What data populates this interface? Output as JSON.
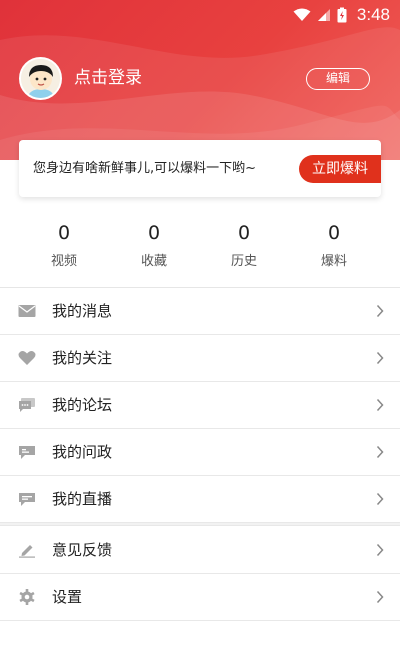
{
  "status_bar": {
    "time": "3:48"
  },
  "profile": {
    "login_text": "点击登录",
    "edit_label": "编辑"
  },
  "tip": {
    "text": "您身边有啥新鲜事儿,可以爆料一下哟~",
    "button_label": "立即爆料"
  },
  "stats": [
    {
      "value": "0",
      "label": "视频"
    },
    {
      "value": "0",
      "label": "收藏"
    },
    {
      "value": "0",
      "label": "历史"
    },
    {
      "value": "0",
      "label": "爆料"
    }
  ],
  "menu_group_1": [
    {
      "label": "我的消息",
      "icon": "envelope-icon"
    },
    {
      "label": "我的关注",
      "icon": "heart-icon"
    },
    {
      "label": "我的论坛",
      "icon": "forum-chat-icon"
    },
    {
      "label": "我的问政",
      "icon": "message-icon"
    },
    {
      "label": "我的直播",
      "icon": "live-chat-icon"
    }
  ],
  "menu_group_2": [
    {
      "label": "意见反馈",
      "icon": "pen-icon"
    },
    {
      "label": "设置",
      "icon": "gear-icon"
    }
  ],
  "colors": {
    "header_red": "#e0323a",
    "accent_button": "#e0311c",
    "icon_gray": "#9a9a9a"
  }
}
